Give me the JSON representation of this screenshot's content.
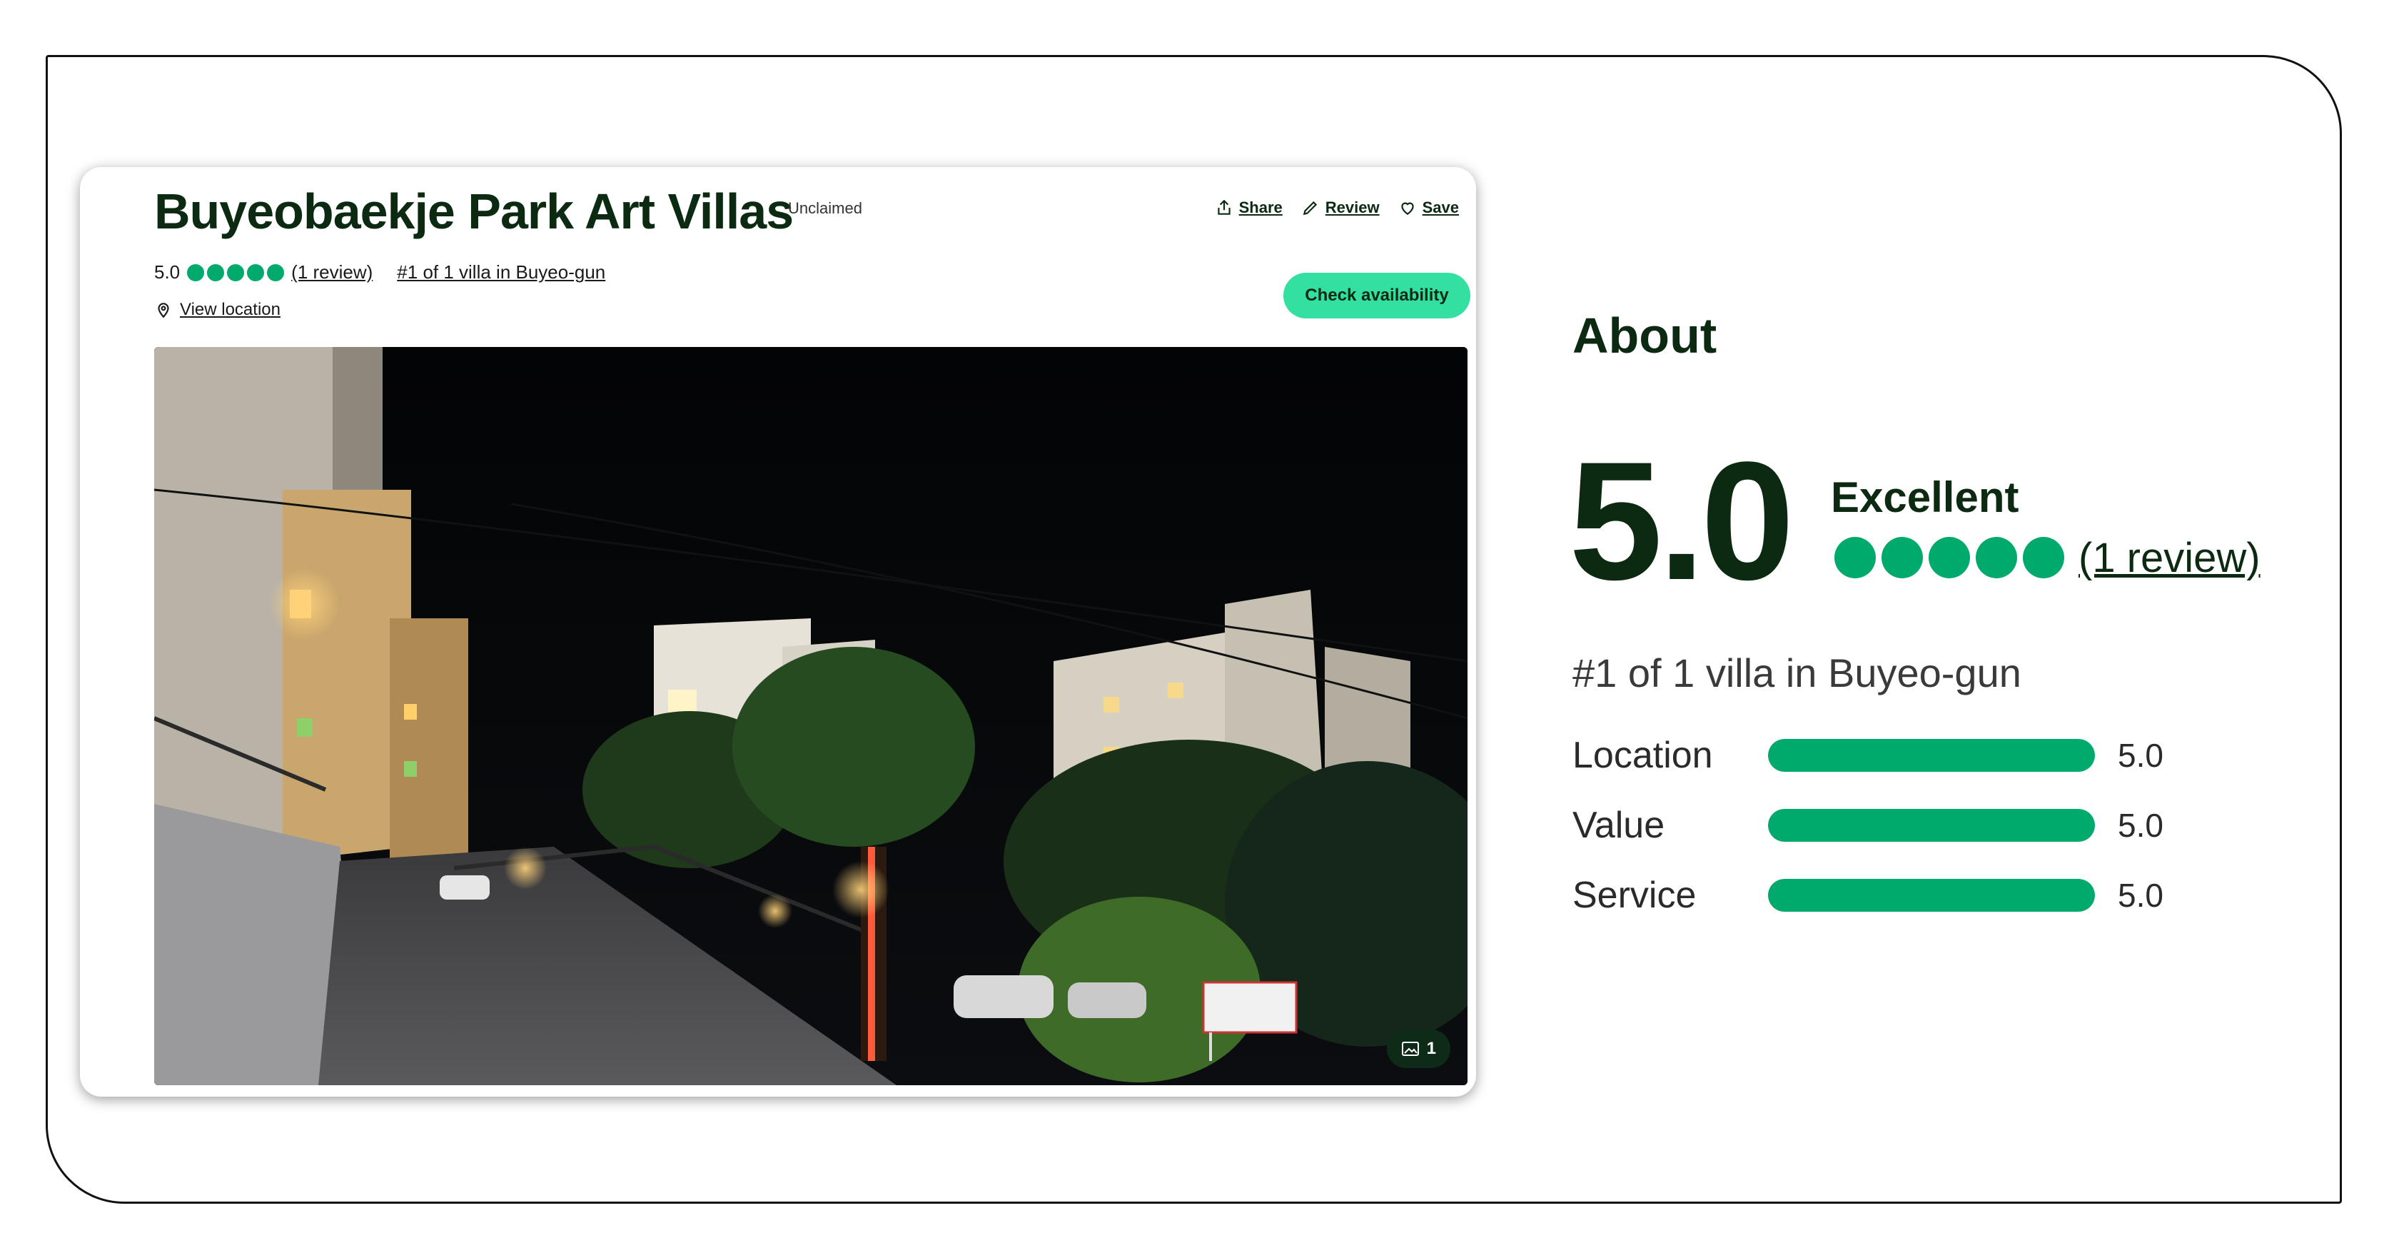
{
  "listing": {
    "title": "Buyeobaekje Park Art Villas",
    "claim_status": "Unclaimed",
    "rating": "5.0",
    "rating_bubbles": 5,
    "review_link": "(1 review)",
    "rank": "#1 of 1 villa in Buyeo-gun",
    "view_location": "View location",
    "check_availability": "Check availability",
    "photo_count": "1"
  },
  "actions": {
    "share": "Share",
    "review": "Review",
    "save": "Save"
  },
  "about": {
    "title": "About",
    "score": "5.0",
    "score_label": "Excellent",
    "review_link": "(1 review)",
    "rank": "#1 of 1 villa in Buyeo-gun",
    "subratings": [
      {
        "label": "Location",
        "value": "5.0",
        "fill": 1.0
      },
      {
        "label": "Value",
        "value": "5.0",
        "fill": 1.0
      },
      {
        "label": "Service",
        "value": "5.0",
        "fill": 1.0
      }
    ]
  },
  "colors": {
    "accent_green": "#00aa6c",
    "button_green": "#34e0a1",
    "dark_text": "#0c2a12"
  },
  "icons": [
    "share-icon",
    "pencil-icon",
    "heart-icon",
    "map-pin-icon",
    "photo-icon"
  ]
}
